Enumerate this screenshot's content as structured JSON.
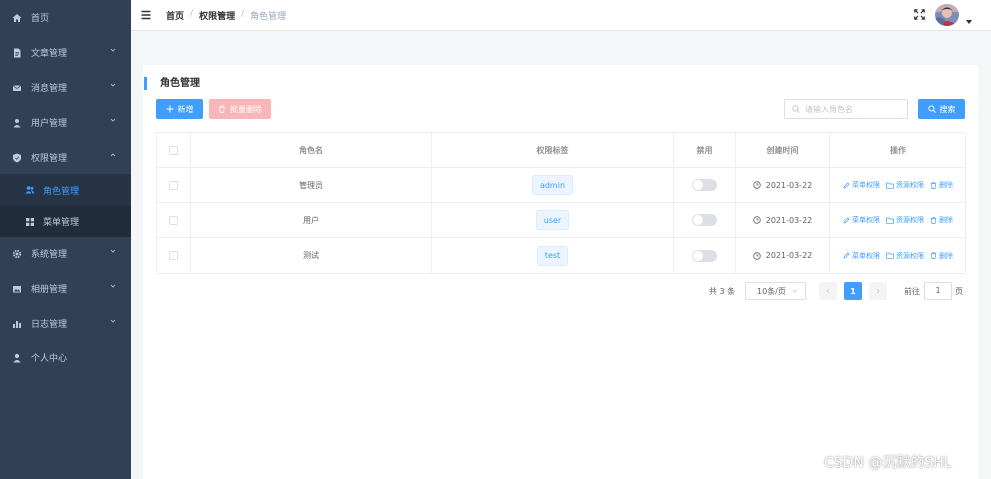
{
  "sidebar": {
    "items": [
      {
        "label": "首页",
        "icon": "home-icon"
      },
      {
        "label": "文章管理",
        "icon": "document-icon"
      },
      {
        "label": "消息管理",
        "icon": "mail-icon"
      },
      {
        "label": "用户管理",
        "icon": "user-icon"
      },
      {
        "label": "权限管理",
        "icon": "shield-icon"
      },
      {
        "label": "角色管理",
        "icon": "users-icon"
      },
      {
        "label": "菜单管理",
        "icon": "grid-icon"
      },
      {
        "label": "系统管理",
        "icon": "gear-icon"
      },
      {
        "label": "相册管理",
        "icon": "image-icon"
      },
      {
        "label": "日志管理",
        "icon": "chart-icon"
      },
      {
        "label": "个人中心",
        "icon": "person-icon"
      }
    ]
  },
  "navbar": {
    "breadcrumb": [
      "首页",
      "权限管理",
      "角色管理"
    ]
  },
  "main": {
    "title": "角色管理",
    "add_label": "新增",
    "batch_delete_label": "批量删除",
    "search": {
      "placeholder": "请输入角色名",
      "button_label": "搜索"
    },
    "table": {
      "headers": [
        "角色名",
        "权限标签",
        "禁用",
        "创建时间",
        "操作"
      ],
      "rows": [
        {
          "name": "管理员",
          "tag": "admin",
          "disabled": false,
          "created": "2021-03-22"
        },
        {
          "name": "用户",
          "tag": "user",
          "disabled": false,
          "created": "2021-03-22"
        },
        {
          "name": "测试",
          "tag": "test",
          "disabled": false,
          "created": "2021-03-22"
        }
      ],
      "actions": {
        "menu": "菜单权限",
        "resource": "资源权限",
        "delete": "删除"
      }
    },
    "pagination": {
      "total_text": "共 3 条",
      "page_size": "10条/页",
      "current_page": "1",
      "goto_label": "前往",
      "goto_value": "1",
      "page_suffix": "页"
    }
  },
  "watermark": "CSDN @沉默的SHL",
  "colors": {
    "sidebar_bg": "#304156",
    "accent": "#409eff",
    "danger_disabled": "#fab6b6"
  }
}
